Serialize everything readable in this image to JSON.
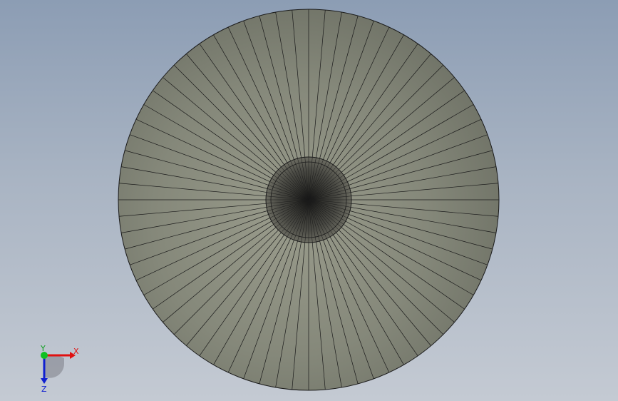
{
  "viewport": {
    "background_top": "#8c9db4",
    "background_bottom": "#c4cad3"
  },
  "model": {
    "face_color": "#8a8d7c",
    "edge_color": "#1a1a1a",
    "inner_face_color": "#3a3a35",
    "segments": 72
  },
  "triad": {
    "x_label": "X",
    "y_label": "Y",
    "z_label": "Z",
    "x_color": "#e01010",
    "y_color": "#10c020",
    "z_color": "#1020d0"
  }
}
